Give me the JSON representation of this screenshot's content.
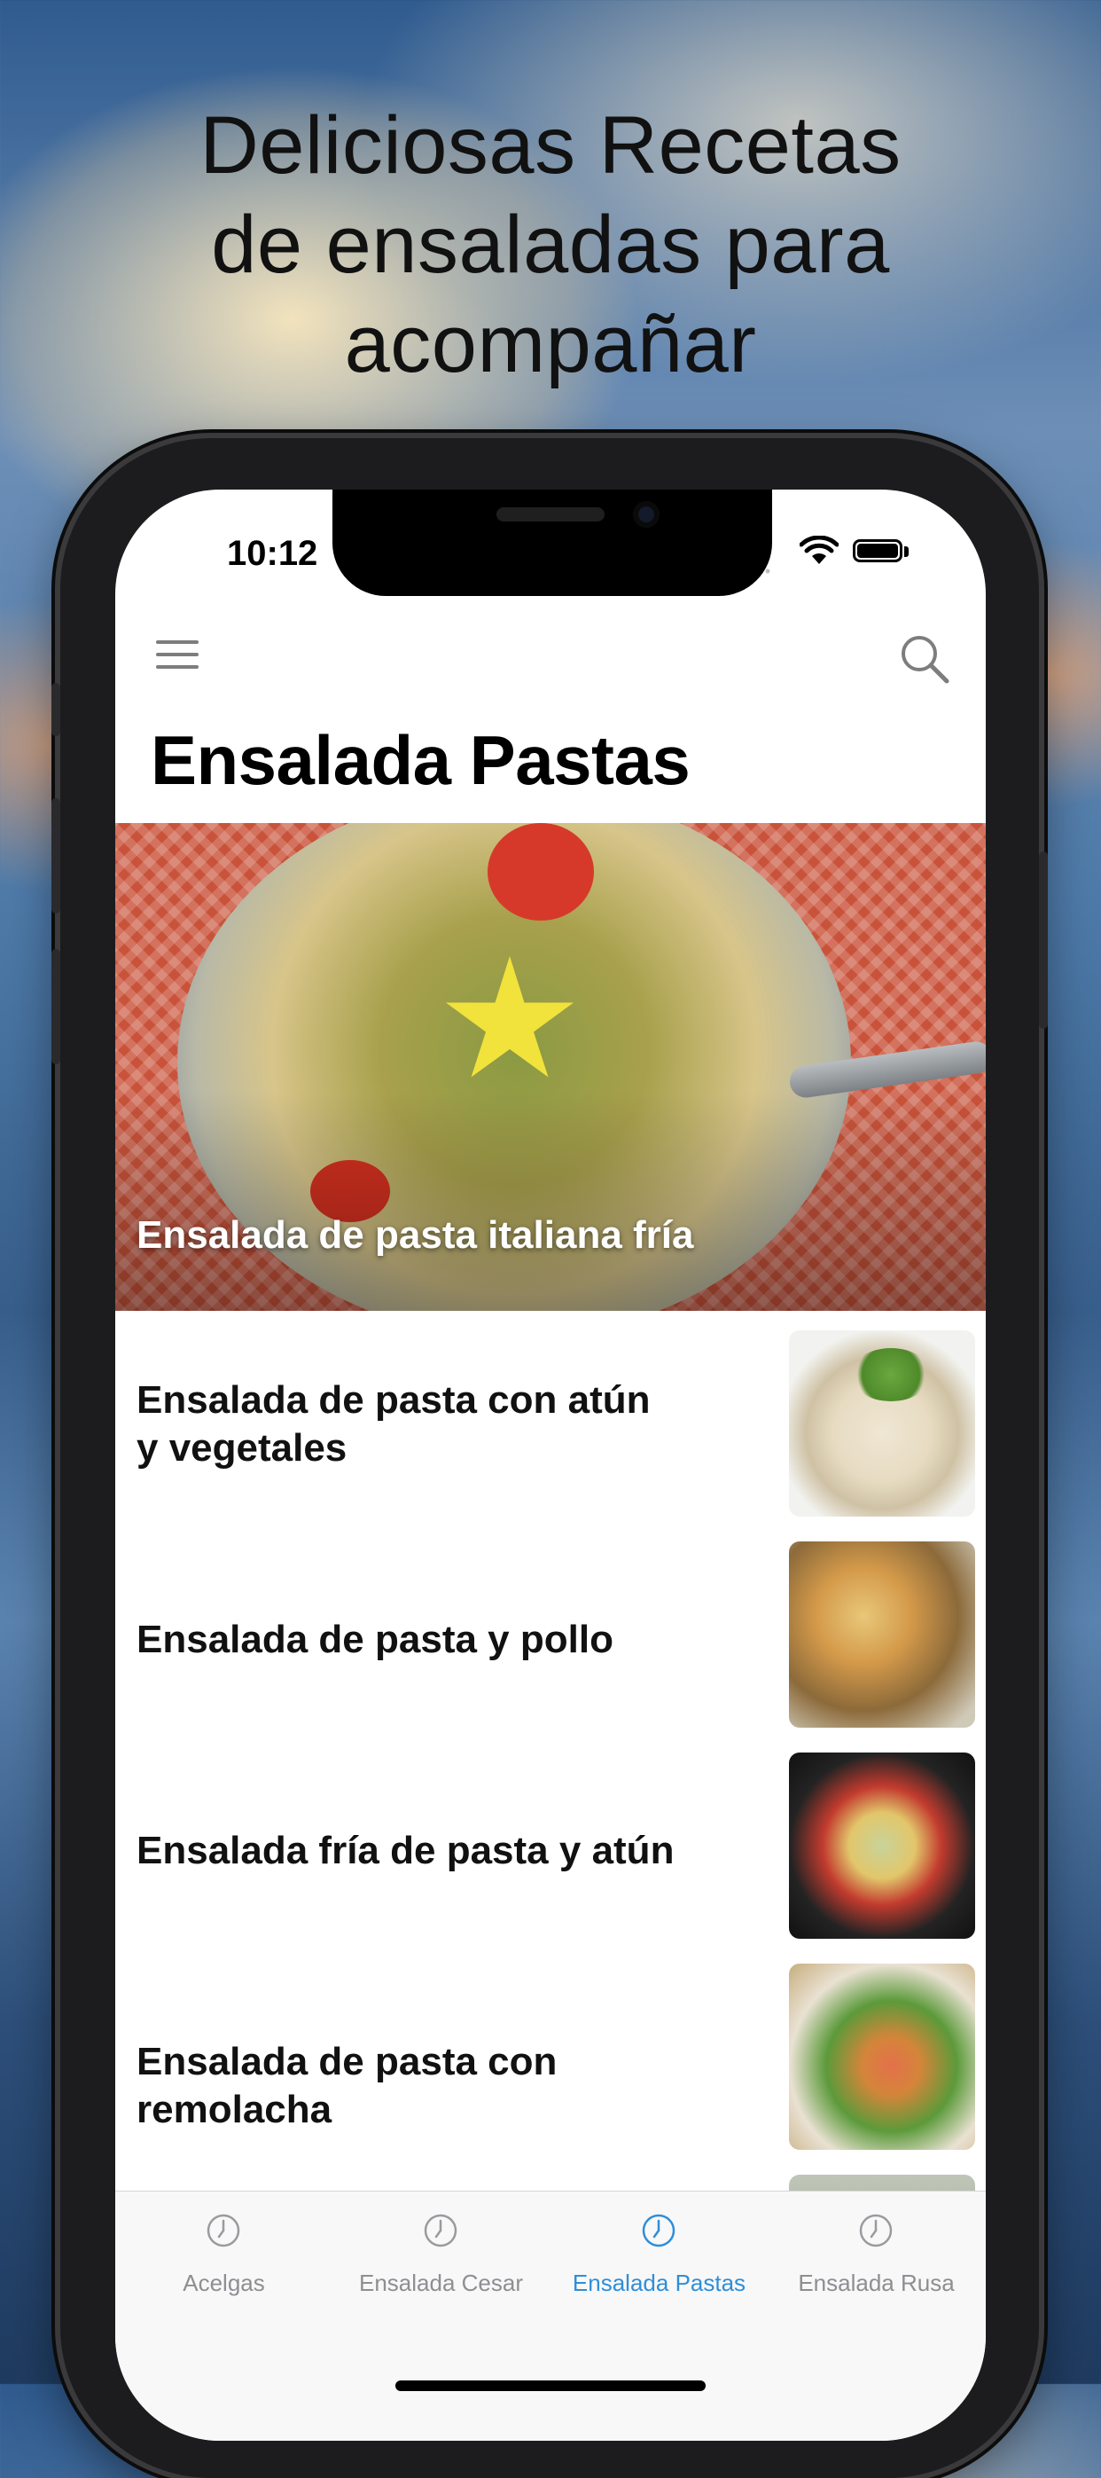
{
  "headline": {
    "line1": "Deliciosas Recetas",
    "line2": "de ensaladas para",
    "line3": "acompañar"
  },
  "status_bar": {
    "time": "10:12",
    "signal_dots": "••••"
  },
  "nav": {
    "title": "Ensalada Pastas",
    "menu_icon": "hamburger-menu-icon",
    "search_icon": "search-icon"
  },
  "featured": {
    "title": "Ensalada de pasta italiana fría"
  },
  "recipes": [
    {
      "title": "Ensalada de pasta con atún y vegetales"
    },
    {
      "title": "Ensalada de pasta y pollo"
    },
    {
      "title": "Ensalada fría de pasta y atún"
    },
    {
      "title": "Ensalada de pasta con remolacha"
    }
  ],
  "tabs": [
    {
      "label": "Acelgas",
      "icon": "clock-icon",
      "active": false
    },
    {
      "label": "Ensalada Cesar",
      "icon": "clock-icon",
      "active": false
    },
    {
      "label": "Ensalada Pastas",
      "icon": "clock-icon",
      "active": true
    },
    {
      "label": "Ensalada Rusa",
      "icon": "clock-icon",
      "active": false
    }
  ],
  "colors": {
    "active_tab": "#2f8ed8",
    "inactive_tab": "#8e8e93",
    "text": "#111111"
  }
}
